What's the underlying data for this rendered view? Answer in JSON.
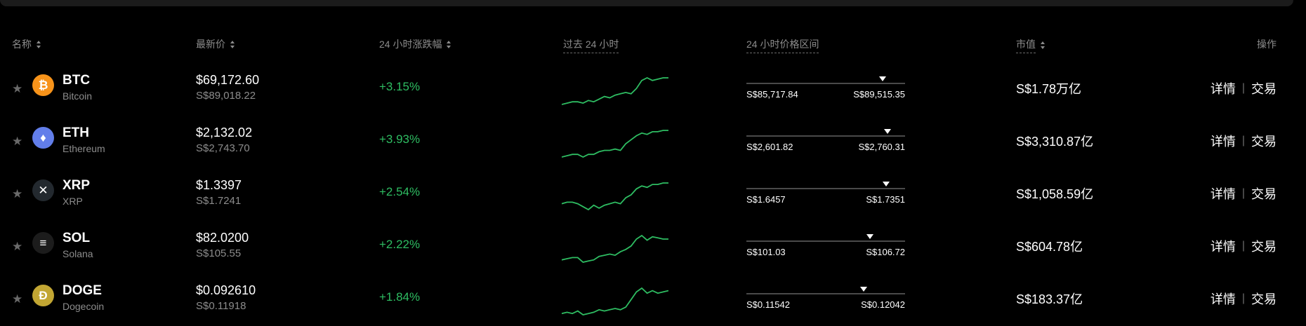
{
  "header": {
    "name": "名称",
    "price": "最新价",
    "change": "24 小时涨跌幅",
    "past24h": "过去 24 小时",
    "range": "24 小时价格区间",
    "mcap": "市值",
    "actions": "操作"
  },
  "actions": {
    "detail": "详情",
    "trade": "交易",
    "separator": "|"
  },
  "colors": {
    "up": "#2ebd62",
    "muted": "#8c8c8c",
    "background": "#000000"
  },
  "rows": [
    {
      "symbol": "BTC",
      "name": "Bitcoin",
      "icon": "bitcoin-icon",
      "icon_color": "#f7931a",
      "price": "$69,172.60",
      "price_local": "S$89,018.22",
      "change": "+3.15%",
      "range_low": "S$85,717.84",
      "range_high": "S$89,515.35",
      "range_position": 0.86,
      "market_cap": "S$1.78万亿",
      "spark": [
        20,
        21,
        22,
        22,
        21,
        23,
        22,
        24,
        26,
        25,
        27,
        28,
        29,
        28,
        32,
        38,
        40,
        38,
        39,
        40,
        40
      ]
    },
    {
      "symbol": "ETH",
      "name": "Ethereum",
      "icon": "ethereum-icon",
      "icon_color": "#627eea",
      "price": "$2,132.02",
      "price_local": "S$2,743.70",
      "change": "+3.93%",
      "range_low": "S$2,601.82",
      "range_high": "S$2,760.31",
      "range_position": 0.89,
      "market_cap": "S$3,310.87亿",
      "spark": [
        20,
        21,
        22,
        22,
        20,
        22,
        22,
        24,
        25,
        25,
        26,
        25,
        30,
        33,
        36,
        38,
        37,
        39,
        39,
        40,
        40
      ]
    },
    {
      "symbol": "XRP",
      "name": "XRP",
      "icon": "xrp-icon",
      "icon_color": "#23292f",
      "price": "$1.3397",
      "price_local": "S$1.7241",
      "change": "+2.54%",
      "range_low": "S$1.6457",
      "range_high": "S$1.7351",
      "range_position": 0.88,
      "market_cap": "S$1,058.59亿",
      "spark": [
        26,
        27,
        27,
        26,
        24,
        22,
        25,
        23,
        25,
        26,
        27,
        26,
        30,
        32,
        36,
        38,
        37,
        39,
        39,
        40,
        40
      ]
    },
    {
      "symbol": "SOL",
      "name": "Solana",
      "icon": "solana-icon",
      "icon_color": "#1c1c1c",
      "price": "$82.0200",
      "price_local": "S$105.55",
      "change": "+2.22%",
      "range_low": "S$101.03",
      "range_high": "S$106.72",
      "range_position": 0.78,
      "market_cap": "S$604.78亿",
      "spark": [
        22,
        23,
        24,
        24,
        20,
        21,
        22,
        25,
        26,
        27,
        26,
        29,
        31,
        34,
        40,
        43,
        39,
        42,
        41,
        40,
        40
      ]
    },
    {
      "symbol": "DOGE",
      "name": "Dogecoin",
      "icon": "dogecoin-icon",
      "icon_color": "#c2a633",
      "price": "$0.092610",
      "price_local": "S$0.11918",
      "change": "+1.84%",
      "range_low": "S$0.11542",
      "range_high": "S$0.12042",
      "range_position": 0.74,
      "market_cap": "S$183.37亿",
      "spark": [
        22,
        23,
        22,
        24,
        21,
        22,
        23,
        25,
        24,
        25,
        26,
        25,
        27,
        33,
        39,
        42,
        38,
        40,
        38,
        39,
        40
      ]
    }
  ]
}
